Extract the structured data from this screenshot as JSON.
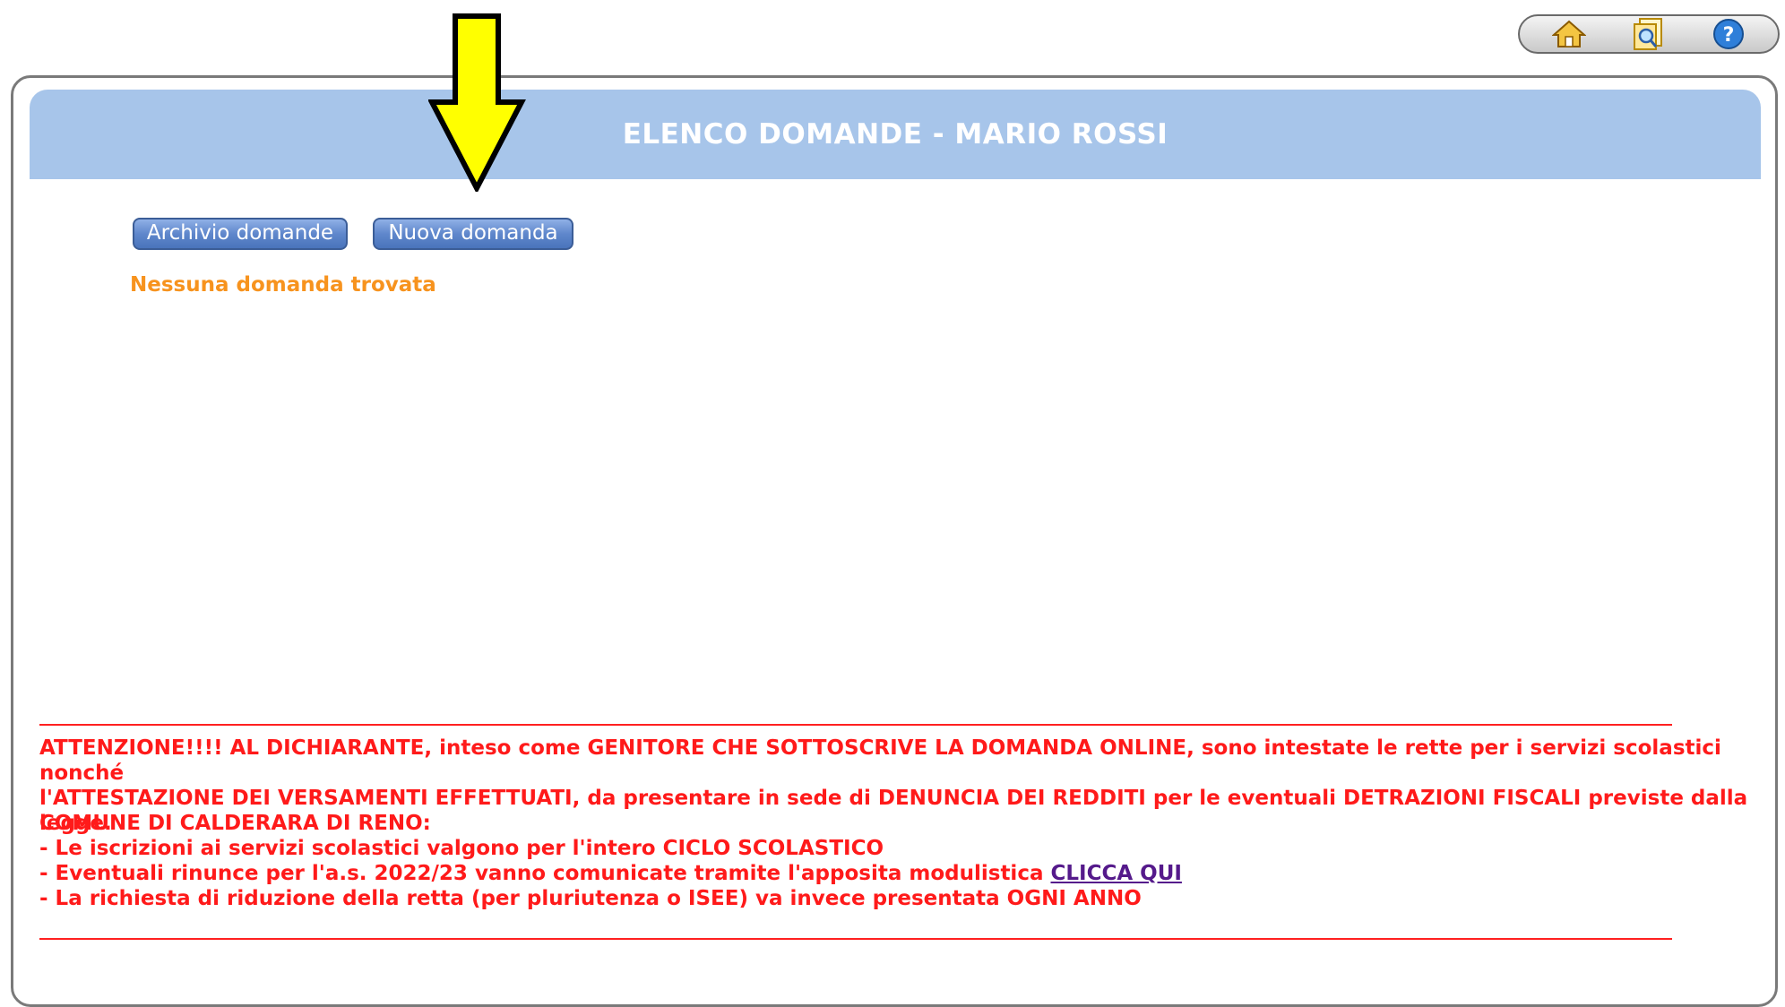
{
  "toolbar": {
    "icons": [
      "home-icon",
      "search-document-icon",
      "help-icon"
    ]
  },
  "panel": {
    "title": "ELENCO DOMANDE - MARIO ROSSI"
  },
  "buttons": {
    "archivio_label": "Archivio domande",
    "nuova_label": "Nuova domanda"
  },
  "empty_message": "Nessuna domanda trovata",
  "notice": {
    "attenzione_line1": "ATTENZIONE!!!! AL DICHIARANTE, inteso come GENITORE CHE SOTTOSCRIVE LA DOMANDA ONLINE, sono intestate le rette per i servizi scolastici nonché",
    "attenzione_line2": "l'ATTESTAZIONE DEI VERSAMENTI EFFETTUATI, da presentare in sede di DENUNCIA DEI REDDITI per le eventuali DETRAZIONI FISCALI previste dalla legge.",
    "comune_heading": "COMUNE DI CALDERARA DI RENO:",
    "item1": "- Le iscrizioni ai servizi scolastici valgono per l'intero CICLO SCOLASTICO",
    "item2_prefix": "- Eventuali rinunce per l'a.s. 2022/23 vanno comunicate tramite l'apposita modulistica ",
    "item2_link": "CLICCA QUI",
    "item3": "- La richiesta di riduzione della retta (per pluriutenza o ISEE) va invece presentata OGNI ANNO"
  },
  "colors": {
    "header_bg": "#a7c5ea",
    "button_blue": "#5f87cc",
    "empty_orange": "#f7931e",
    "notice_red": "#ff1a1a",
    "link_purple": "#551a8b",
    "arrow_yellow": "#ffff00"
  }
}
